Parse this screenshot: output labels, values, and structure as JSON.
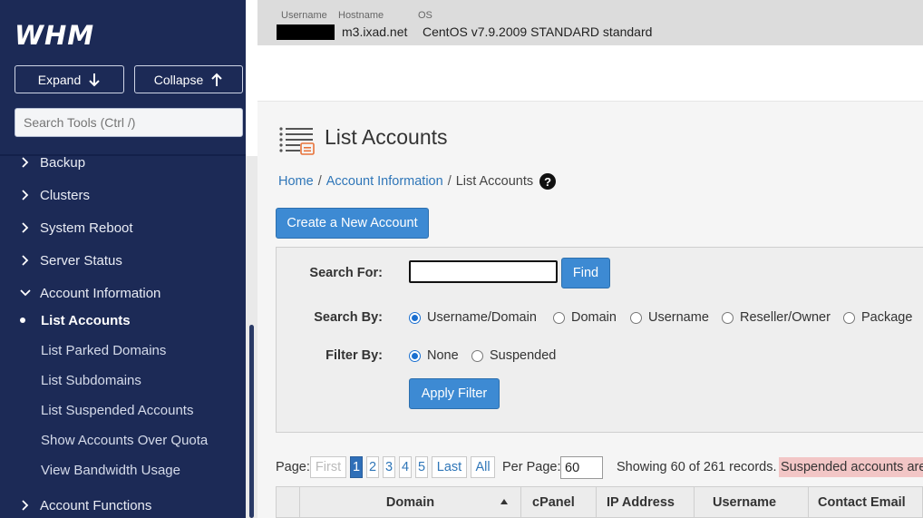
{
  "sidebar": {
    "logo": "WHM",
    "expand_label": "Expand",
    "collapse_label": "Collapse",
    "search_placeholder": "Search Tools (Ctrl /)",
    "items": [
      {
        "label": "Backup"
      },
      {
        "label": "Clusters"
      },
      {
        "label": "System Reboot"
      },
      {
        "label": "Server Status"
      },
      {
        "label": "Account Information"
      }
    ],
    "subitems": [
      {
        "label": "List Accounts"
      },
      {
        "label": "List Parked Domains"
      },
      {
        "label": "List Subdomains"
      },
      {
        "label": "List Suspended Accounts"
      },
      {
        "label": "Show Accounts Over Quota"
      },
      {
        "label": "View Bandwidth Usage"
      }
    ],
    "bottom_item": "Account Functions"
  },
  "topbar": {
    "username_label": "Username",
    "hostname_label": "Hostname",
    "os_label": "OS",
    "hostname": "m3.ixad.net",
    "os": "CentOS v7.9.2009 STANDARD standard"
  },
  "page": {
    "title": "List Accounts",
    "breadcrumb": [
      "Home",
      "Account Information",
      "List Accounts"
    ],
    "help": "?",
    "create_button": "Create a New Account"
  },
  "search": {
    "search_for_label": "Search For:",
    "find_button": "Find",
    "search_by_label": "Search By:",
    "search_by_options": [
      "Username/Domain",
      "Domain",
      "Username",
      "Reseller/Owner",
      "Package"
    ],
    "filter_by_label": "Filter By:",
    "filter_by_options": [
      "None",
      "Suspended"
    ],
    "apply_button": "Apply Filter"
  },
  "pagination": {
    "page_label": "Page:",
    "first": "First",
    "pages": [
      "1",
      "2",
      "3",
      "4",
      "5"
    ],
    "last": "Last",
    "all": "All",
    "per_page_label": "Per Page:",
    "per_page_value": "60",
    "records_text": "Showing 60 of 261 records.",
    "suspended_note": "Suspended accounts are"
  },
  "table": {
    "columns": [
      "Domain",
      "cPanel",
      "IP Address",
      "Username",
      "Contact Email"
    ]
  }
}
